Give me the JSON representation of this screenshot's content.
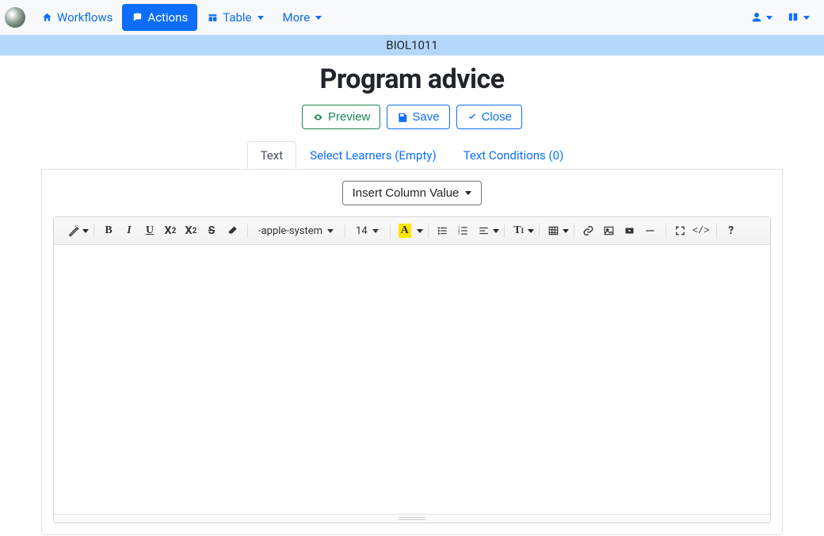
{
  "nav": {
    "workflows": "Workflows",
    "actions": "Actions",
    "table": "Table",
    "more": "More"
  },
  "banner": "BIOL1011",
  "title": "Program advice",
  "buttons": {
    "preview": "Preview",
    "save": "Save",
    "close": "Close"
  },
  "tabs": {
    "text": "Text",
    "learners": "Select Learners (Empty)",
    "conditions": "Text Conditions (0)"
  },
  "insert": "Insert Column Value",
  "toolbar": {
    "font": "-apple-system",
    "size": "14",
    "color_letter": "A"
  }
}
